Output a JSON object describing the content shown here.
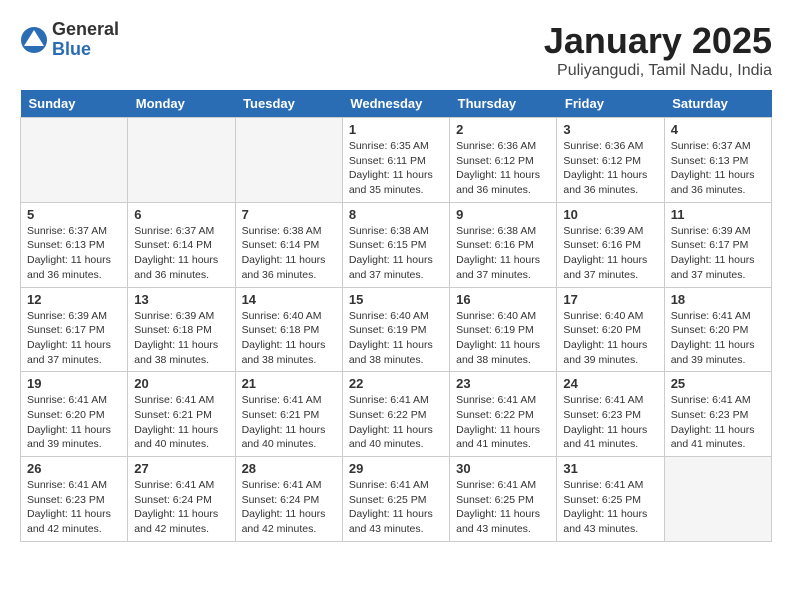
{
  "header": {
    "logo_line1": "General",
    "logo_line2": "Blue",
    "month": "January 2025",
    "location": "Puliyangudi, Tamil Nadu, India"
  },
  "weekdays": [
    "Sunday",
    "Monday",
    "Tuesday",
    "Wednesday",
    "Thursday",
    "Friday",
    "Saturday"
  ],
  "weeks": [
    [
      {
        "day": "",
        "empty": true
      },
      {
        "day": "",
        "empty": true
      },
      {
        "day": "",
        "empty": true
      },
      {
        "day": "1",
        "sunrise": "6:35 AM",
        "sunset": "6:11 PM",
        "daylight": "11 hours and 35 minutes."
      },
      {
        "day": "2",
        "sunrise": "6:36 AM",
        "sunset": "6:12 PM",
        "daylight": "11 hours and 36 minutes."
      },
      {
        "day": "3",
        "sunrise": "6:36 AM",
        "sunset": "6:12 PM",
        "daylight": "11 hours and 36 minutes."
      },
      {
        "day": "4",
        "sunrise": "6:37 AM",
        "sunset": "6:13 PM",
        "daylight": "11 hours and 36 minutes."
      }
    ],
    [
      {
        "day": "5",
        "sunrise": "6:37 AM",
        "sunset": "6:13 PM",
        "daylight": "11 hours and 36 minutes."
      },
      {
        "day": "6",
        "sunrise": "6:37 AM",
        "sunset": "6:14 PM",
        "daylight": "11 hours and 36 minutes."
      },
      {
        "day": "7",
        "sunrise": "6:38 AM",
        "sunset": "6:14 PM",
        "daylight": "11 hours and 36 minutes."
      },
      {
        "day": "8",
        "sunrise": "6:38 AM",
        "sunset": "6:15 PM",
        "daylight": "11 hours and 37 minutes."
      },
      {
        "day": "9",
        "sunrise": "6:38 AM",
        "sunset": "6:16 PM",
        "daylight": "11 hours and 37 minutes."
      },
      {
        "day": "10",
        "sunrise": "6:39 AM",
        "sunset": "6:16 PM",
        "daylight": "11 hours and 37 minutes."
      },
      {
        "day": "11",
        "sunrise": "6:39 AM",
        "sunset": "6:17 PM",
        "daylight": "11 hours and 37 minutes."
      }
    ],
    [
      {
        "day": "12",
        "sunrise": "6:39 AM",
        "sunset": "6:17 PM",
        "daylight": "11 hours and 37 minutes."
      },
      {
        "day": "13",
        "sunrise": "6:39 AM",
        "sunset": "6:18 PM",
        "daylight": "11 hours and 38 minutes."
      },
      {
        "day": "14",
        "sunrise": "6:40 AM",
        "sunset": "6:18 PM",
        "daylight": "11 hours and 38 minutes."
      },
      {
        "day": "15",
        "sunrise": "6:40 AM",
        "sunset": "6:19 PM",
        "daylight": "11 hours and 38 minutes."
      },
      {
        "day": "16",
        "sunrise": "6:40 AM",
        "sunset": "6:19 PM",
        "daylight": "11 hours and 38 minutes."
      },
      {
        "day": "17",
        "sunrise": "6:40 AM",
        "sunset": "6:20 PM",
        "daylight": "11 hours and 39 minutes."
      },
      {
        "day": "18",
        "sunrise": "6:41 AM",
        "sunset": "6:20 PM",
        "daylight": "11 hours and 39 minutes."
      }
    ],
    [
      {
        "day": "19",
        "sunrise": "6:41 AM",
        "sunset": "6:20 PM",
        "daylight": "11 hours and 39 minutes."
      },
      {
        "day": "20",
        "sunrise": "6:41 AM",
        "sunset": "6:21 PM",
        "daylight": "11 hours and 40 minutes."
      },
      {
        "day": "21",
        "sunrise": "6:41 AM",
        "sunset": "6:21 PM",
        "daylight": "11 hours and 40 minutes."
      },
      {
        "day": "22",
        "sunrise": "6:41 AM",
        "sunset": "6:22 PM",
        "daylight": "11 hours and 40 minutes."
      },
      {
        "day": "23",
        "sunrise": "6:41 AM",
        "sunset": "6:22 PM",
        "daylight": "11 hours and 41 minutes."
      },
      {
        "day": "24",
        "sunrise": "6:41 AM",
        "sunset": "6:23 PM",
        "daylight": "11 hours and 41 minutes."
      },
      {
        "day": "25",
        "sunrise": "6:41 AM",
        "sunset": "6:23 PM",
        "daylight": "11 hours and 41 minutes."
      }
    ],
    [
      {
        "day": "26",
        "sunrise": "6:41 AM",
        "sunset": "6:23 PM",
        "daylight": "11 hours and 42 minutes."
      },
      {
        "day": "27",
        "sunrise": "6:41 AM",
        "sunset": "6:24 PM",
        "daylight": "11 hours and 42 minutes."
      },
      {
        "day": "28",
        "sunrise": "6:41 AM",
        "sunset": "6:24 PM",
        "daylight": "11 hours and 42 minutes."
      },
      {
        "day": "29",
        "sunrise": "6:41 AM",
        "sunset": "6:25 PM",
        "daylight": "11 hours and 43 minutes."
      },
      {
        "day": "30",
        "sunrise": "6:41 AM",
        "sunset": "6:25 PM",
        "daylight": "11 hours and 43 minutes."
      },
      {
        "day": "31",
        "sunrise": "6:41 AM",
        "sunset": "6:25 PM",
        "daylight": "11 hours and 43 minutes."
      },
      {
        "day": "",
        "empty": true
      }
    ]
  ]
}
